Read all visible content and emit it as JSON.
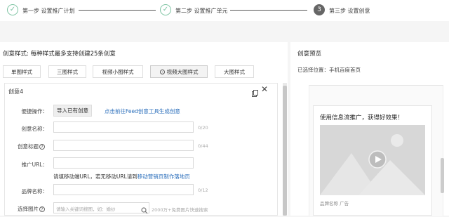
{
  "stepper": {
    "steps": [
      {
        "label": "第一步 设置推广计划",
        "state": "done",
        "mark": "✓"
      },
      {
        "label": "第二步 设置推广单元",
        "state": "done",
        "mark": "✓"
      },
      {
        "label": "第三步 设置创意",
        "state": "active",
        "mark": "3"
      }
    ]
  },
  "creative": {
    "section_title": "创意样式: 每种样式最多支持创建25条创意",
    "tabs": [
      {
        "label": "单图样式"
      },
      {
        "label": "三图样式"
      },
      {
        "label": "视频小图样式"
      },
      {
        "label": "视频大图样式",
        "active": true,
        "icon": "eye-icon"
      },
      {
        "label": "大图样式"
      }
    ],
    "card": {
      "title": "创意4",
      "actions": {
        "label": "便捷操作：",
        "import_button": "导入已有创意",
        "feed_link": "点击前往Feed创意工具生成创意"
      },
      "name": {
        "label": "创意名称：",
        "count": "0/20"
      },
      "headline": {
        "label": "创意标题",
        "count": "0/44"
      },
      "url": {
        "label": "推广URL：",
        "tip": "请填移动端URL，若无移动URL请到",
        "tip_link": "移动营销页制作落地页"
      },
      "brand": {
        "label": "品牌名称：",
        "count": "0/12"
      },
      "images": {
        "label": "选择图片",
        "placeholder": "请输入关键词搜图，如：婚纱",
        "hint": "2000万+免费图片快速搜索"
      }
    }
  },
  "preview": {
    "title": "创意预览",
    "position": "已选择位置：手机百度首页",
    "ad_title": "使用信息流推广，获得好效果！",
    "brand_line": "品牌名称 广告"
  }
}
